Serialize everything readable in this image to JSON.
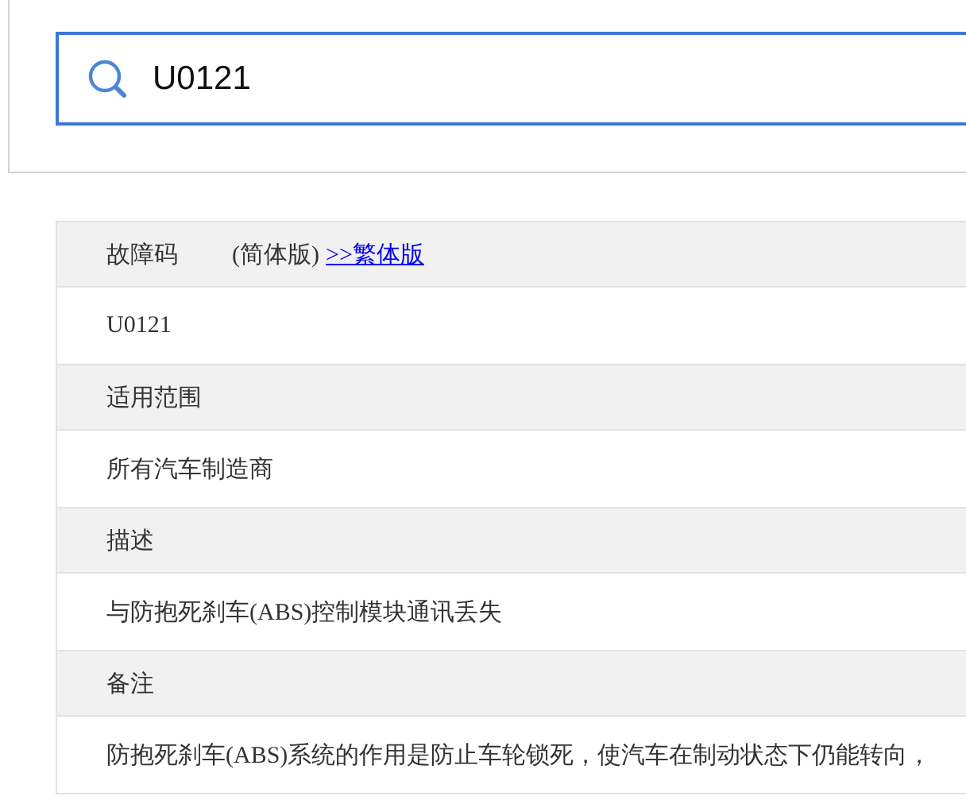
{
  "search": {
    "value": "U0121"
  },
  "sections": [
    {
      "label": "故障码",
      "note": "(简体版)",
      "link": ">>繁体版",
      "value": "U0121"
    },
    {
      "label": "适用范围",
      "value": "所有汽车制造商"
    },
    {
      "label": "描述",
      "value": "与防抱死刹车(ABS)控制模块通讯丢失"
    },
    {
      "label": "备注",
      "value": "防抱死刹车(ABS)系统的作用是防止车轮锁死，使汽车在制动状态下仍能转向，"
    }
  ]
}
